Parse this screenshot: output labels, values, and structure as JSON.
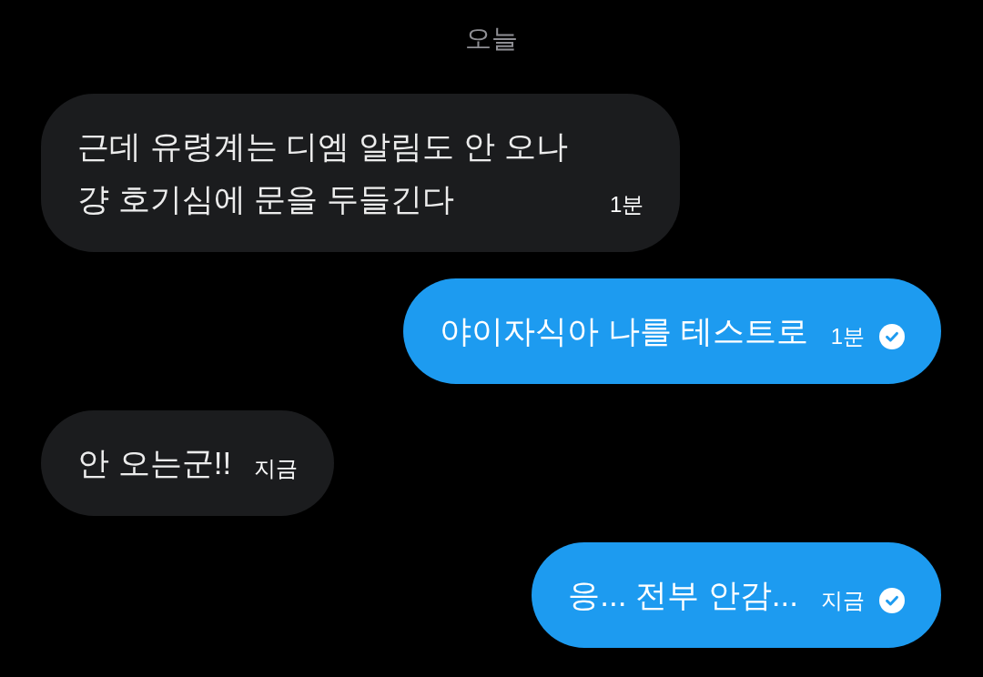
{
  "date_divider": {
    "label": "오늘"
  },
  "messages": [
    {
      "kind": "incoming",
      "text": "근데 유령계는 디엠 알림도 안 오나 걍 호기심에 문을 두들긴다",
      "time": "1분",
      "read": false
    },
    {
      "kind": "outgoing",
      "text": "야이자식아 나를 테스트로",
      "time": "1분",
      "read": true
    },
    {
      "kind": "incoming",
      "text": "안 오는군!!",
      "time": "지금",
      "read": false
    },
    {
      "kind": "outgoing",
      "text": "응... 전부 안감...",
      "time": "지금",
      "read": true
    }
  ]
}
